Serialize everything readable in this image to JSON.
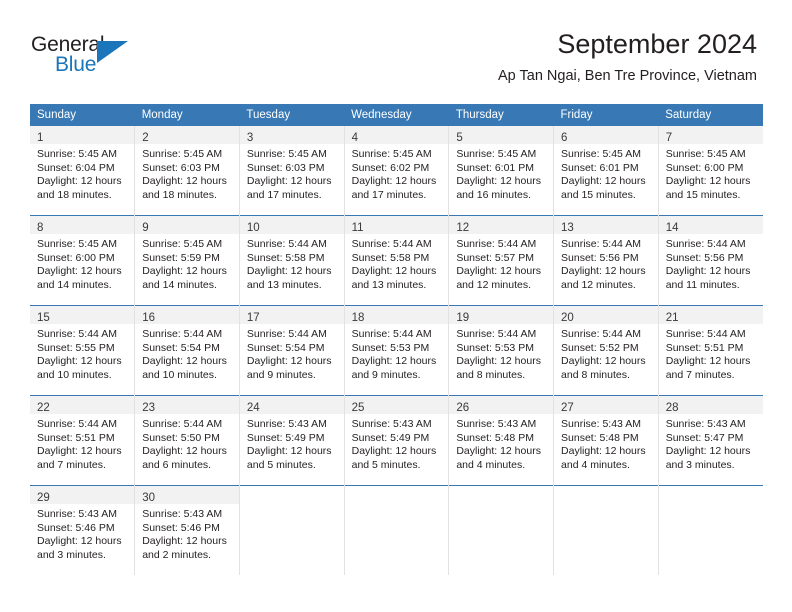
{
  "brand": {
    "name_top": "General",
    "name_bottom": "Blue",
    "accent_color": "#1b75bb"
  },
  "header": {
    "title": "September 2024",
    "subtitle": "Ap Tan Ngai, Ben Tre Province, Vietnam"
  },
  "theme": {
    "header_row_bg": "#3878b4",
    "daynum_band_bg": "#f2f2f2",
    "row_divider": "#3878b4",
    "column_divider": "#e2e2e2",
    "text_color": "#231f20"
  },
  "columns": [
    "Sunday",
    "Monday",
    "Tuesday",
    "Wednesday",
    "Thursday",
    "Friday",
    "Saturday"
  ],
  "weeks": [
    [
      {
        "day": "1",
        "sunrise": "Sunrise: 5:45 AM",
        "sunset": "Sunset: 6:04 PM",
        "daylight_1": "Daylight: 12 hours",
        "daylight_2": "and 18 minutes."
      },
      {
        "day": "2",
        "sunrise": "Sunrise: 5:45 AM",
        "sunset": "Sunset: 6:03 PM",
        "daylight_1": "Daylight: 12 hours",
        "daylight_2": "and 18 minutes."
      },
      {
        "day": "3",
        "sunrise": "Sunrise: 5:45 AM",
        "sunset": "Sunset: 6:03 PM",
        "daylight_1": "Daylight: 12 hours",
        "daylight_2": "and 17 minutes."
      },
      {
        "day": "4",
        "sunrise": "Sunrise: 5:45 AM",
        "sunset": "Sunset: 6:02 PM",
        "daylight_1": "Daylight: 12 hours",
        "daylight_2": "and 17 minutes."
      },
      {
        "day": "5",
        "sunrise": "Sunrise: 5:45 AM",
        "sunset": "Sunset: 6:01 PM",
        "daylight_1": "Daylight: 12 hours",
        "daylight_2": "and 16 minutes."
      },
      {
        "day": "6",
        "sunrise": "Sunrise: 5:45 AM",
        "sunset": "Sunset: 6:01 PM",
        "daylight_1": "Daylight: 12 hours",
        "daylight_2": "and 15 minutes."
      },
      {
        "day": "7",
        "sunrise": "Sunrise: 5:45 AM",
        "sunset": "Sunset: 6:00 PM",
        "daylight_1": "Daylight: 12 hours",
        "daylight_2": "and 15 minutes."
      }
    ],
    [
      {
        "day": "8",
        "sunrise": "Sunrise: 5:45 AM",
        "sunset": "Sunset: 6:00 PM",
        "daylight_1": "Daylight: 12 hours",
        "daylight_2": "and 14 minutes."
      },
      {
        "day": "9",
        "sunrise": "Sunrise: 5:45 AM",
        "sunset": "Sunset: 5:59 PM",
        "daylight_1": "Daylight: 12 hours",
        "daylight_2": "and 14 minutes."
      },
      {
        "day": "10",
        "sunrise": "Sunrise: 5:44 AM",
        "sunset": "Sunset: 5:58 PM",
        "daylight_1": "Daylight: 12 hours",
        "daylight_2": "and 13 minutes."
      },
      {
        "day": "11",
        "sunrise": "Sunrise: 5:44 AM",
        "sunset": "Sunset: 5:58 PM",
        "daylight_1": "Daylight: 12 hours",
        "daylight_2": "and 13 minutes."
      },
      {
        "day": "12",
        "sunrise": "Sunrise: 5:44 AM",
        "sunset": "Sunset: 5:57 PM",
        "daylight_1": "Daylight: 12 hours",
        "daylight_2": "and 12 minutes."
      },
      {
        "day": "13",
        "sunrise": "Sunrise: 5:44 AM",
        "sunset": "Sunset: 5:56 PM",
        "daylight_1": "Daylight: 12 hours",
        "daylight_2": "and 12 minutes."
      },
      {
        "day": "14",
        "sunrise": "Sunrise: 5:44 AM",
        "sunset": "Sunset: 5:56 PM",
        "daylight_1": "Daylight: 12 hours",
        "daylight_2": "and 11 minutes."
      }
    ],
    [
      {
        "day": "15",
        "sunrise": "Sunrise: 5:44 AM",
        "sunset": "Sunset: 5:55 PM",
        "daylight_1": "Daylight: 12 hours",
        "daylight_2": "and 10 minutes."
      },
      {
        "day": "16",
        "sunrise": "Sunrise: 5:44 AM",
        "sunset": "Sunset: 5:54 PM",
        "daylight_1": "Daylight: 12 hours",
        "daylight_2": "and 10 minutes."
      },
      {
        "day": "17",
        "sunrise": "Sunrise: 5:44 AM",
        "sunset": "Sunset: 5:54 PM",
        "daylight_1": "Daylight: 12 hours",
        "daylight_2": "and 9 minutes."
      },
      {
        "day": "18",
        "sunrise": "Sunrise: 5:44 AM",
        "sunset": "Sunset: 5:53 PM",
        "daylight_1": "Daylight: 12 hours",
        "daylight_2": "and 9 minutes."
      },
      {
        "day": "19",
        "sunrise": "Sunrise: 5:44 AM",
        "sunset": "Sunset: 5:53 PM",
        "daylight_1": "Daylight: 12 hours",
        "daylight_2": "and 8 minutes."
      },
      {
        "day": "20",
        "sunrise": "Sunrise: 5:44 AM",
        "sunset": "Sunset: 5:52 PM",
        "daylight_1": "Daylight: 12 hours",
        "daylight_2": "and 8 minutes."
      },
      {
        "day": "21",
        "sunrise": "Sunrise: 5:44 AM",
        "sunset": "Sunset: 5:51 PM",
        "daylight_1": "Daylight: 12 hours",
        "daylight_2": "and 7 minutes."
      }
    ],
    [
      {
        "day": "22",
        "sunrise": "Sunrise: 5:44 AM",
        "sunset": "Sunset: 5:51 PM",
        "daylight_1": "Daylight: 12 hours",
        "daylight_2": "and 7 minutes."
      },
      {
        "day": "23",
        "sunrise": "Sunrise: 5:44 AM",
        "sunset": "Sunset: 5:50 PM",
        "daylight_1": "Daylight: 12 hours",
        "daylight_2": "and 6 minutes."
      },
      {
        "day": "24",
        "sunrise": "Sunrise: 5:43 AM",
        "sunset": "Sunset: 5:49 PM",
        "daylight_1": "Daylight: 12 hours",
        "daylight_2": "and 5 minutes."
      },
      {
        "day": "25",
        "sunrise": "Sunrise: 5:43 AM",
        "sunset": "Sunset: 5:49 PM",
        "daylight_1": "Daylight: 12 hours",
        "daylight_2": "and 5 minutes."
      },
      {
        "day": "26",
        "sunrise": "Sunrise: 5:43 AM",
        "sunset": "Sunset: 5:48 PM",
        "daylight_1": "Daylight: 12 hours",
        "daylight_2": "and 4 minutes."
      },
      {
        "day": "27",
        "sunrise": "Sunrise: 5:43 AM",
        "sunset": "Sunset: 5:48 PM",
        "daylight_1": "Daylight: 12 hours",
        "daylight_2": "and 4 minutes."
      },
      {
        "day": "28",
        "sunrise": "Sunrise: 5:43 AM",
        "sunset": "Sunset: 5:47 PM",
        "daylight_1": "Daylight: 12 hours",
        "daylight_2": "and 3 minutes."
      }
    ],
    [
      {
        "day": "29",
        "sunrise": "Sunrise: 5:43 AM",
        "sunset": "Sunset: 5:46 PM",
        "daylight_1": "Daylight: 12 hours",
        "daylight_2": "and 3 minutes."
      },
      {
        "day": "30",
        "sunrise": "Sunrise: 5:43 AM",
        "sunset": "Sunset: 5:46 PM",
        "daylight_1": "Daylight: 12 hours",
        "daylight_2": "and 2 minutes."
      },
      {
        "day": "",
        "sunrise": "",
        "sunset": "",
        "daylight_1": "",
        "daylight_2": ""
      },
      {
        "day": "",
        "sunrise": "",
        "sunset": "",
        "daylight_1": "",
        "daylight_2": ""
      },
      {
        "day": "",
        "sunrise": "",
        "sunset": "",
        "daylight_1": "",
        "daylight_2": ""
      },
      {
        "day": "",
        "sunrise": "",
        "sunset": "",
        "daylight_1": "",
        "daylight_2": ""
      },
      {
        "day": "",
        "sunrise": "",
        "sunset": "",
        "daylight_1": "",
        "daylight_2": ""
      }
    ]
  ]
}
